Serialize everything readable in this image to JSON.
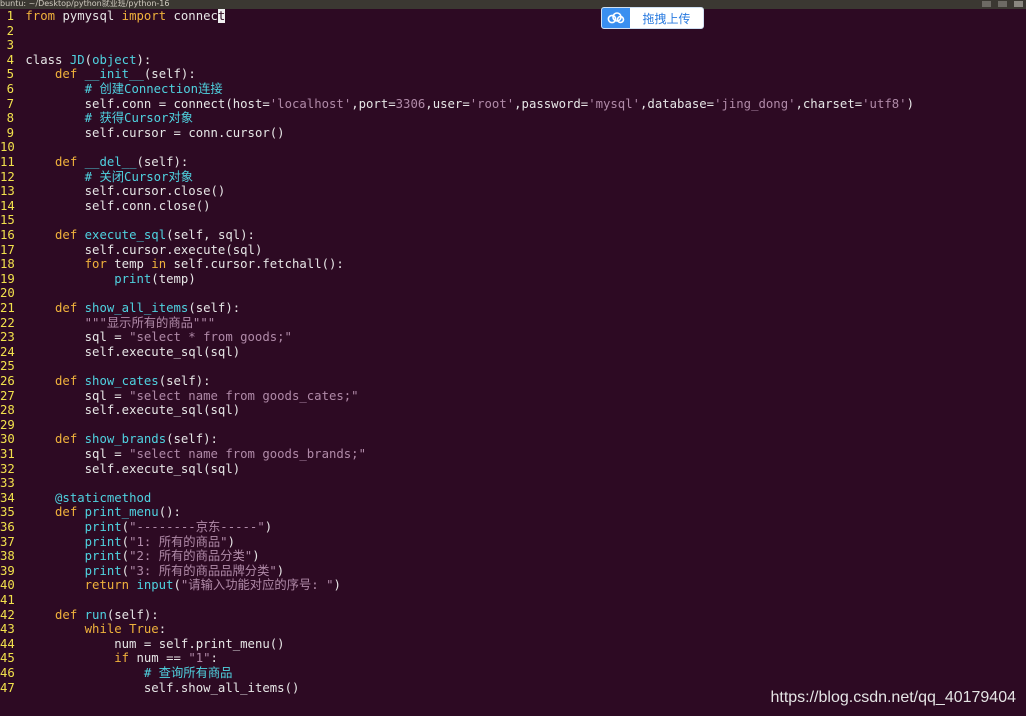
{
  "window": {
    "title": "buntu: ~/Desktop/python就业班/python-16"
  },
  "upload_button": {
    "label": "拖拽上传",
    "icon": "cloud-upload-icon"
  },
  "watermark": {
    "text": "https://blog.csdn.net/qq_40179404"
  },
  "colors": {
    "background": "#2d0a23",
    "line_number": "#f2e14c",
    "keyword": "#f0b23c",
    "function_name": "#4fd2e0",
    "string": "#b08aa8",
    "comment": "#4fd2e0",
    "number": "#b08aa8",
    "text": "#e6e6e6"
  },
  "code_lines": [
    {
      "n": "1",
      "text": "from pymysql import connec"
    },
    {
      "n": "2",
      "text": ""
    },
    {
      "n": "3",
      "text": ""
    },
    {
      "n": "4",
      "text": "class JD(object):"
    },
    {
      "n": "5",
      "text": "    def __init__(self):"
    },
    {
      "n": "6",
      "text": "        # 创建Connection连接"
    },
    {
      "n": "7",
      "text": "        self.conn = connect(host='localhost',port=3306,user='root',password='mysql',database='jing_dong',charset='utf8')"
    },
    {
      "n": "8",
      "text": "        # 获得Cursor对象"
    },
    {
      "n": "9",
      "text": "        self.cursor = conn.cursor()"
    },
    {
      "n": "10",
      "text": ""
    },
    {
      "n": "11",
      "text": "    def __del__(self):"
    },
    {
      "n": "12",
      "text": "        # 关闭Cursor对象"
    },
    {
      "n": "13",
      "text": "        self.cursor.close()"
    },
    {
      "n": "14",
      "text": "        self.conn.close()"
    },
    {
      "n": "15",
      "text": ""
    },
    {
      "n": "16",
      "text": "    def execute_sql(self, sql):"
    },
    {
      "n": "17",
      "text": "        self.cursor.execute(sql)"
    },
    {
      "n": "18",
      "text": "        for temp in self.cursor.fetchall():"
    },
    {
      "n": "19",
      "text": "            print(temp)"
    },
    {
      "n": "20",
      "text": ""
    },
    {
      "n": "21",
      "text": "    def show_all_items(self):"
    },
    {
      "n": "22",
      "text": "        \"\"\"显示所有的商品\"\"\""
    },
    {
      "n": "23",
      "text": "        sql = \"select * from goods;\""
    },
    {
      "n": "24",
      "text": "        self.execute_sql(sql)"
    },
    {
      "n": "25",
      "text": ""
    },
    {
      "n": "26",
      "text": "    def show_cates(self):"
    },
    {
      "n": "27",
      "text": "        sql = \"select name from goods_cates;\""
    },
    {
      "n": "28",
      "text": "        self.execute_sql(sql)"
    },
    {
      "n": "29",
      "text": ""
    },
    {
      "n": "30",
      "text": "    def show_brands(self):"
    },
    {
      "n": "31",
      "text": "        sql = \"select name from goods_brands;\""
    },
    {
      "n": "32",
      "text": "        self.execute_sql(sql)"
    },
    {
      "n": "33",
      "text": ""
    },
    {
      "n": "34",
      "text": "    @staticmethod"
    },
    {
      "n": "35",
      "text": "    def print_menu():"
    },
    {
      "n": "36",
      "text": "        print(\"--------京东-----\")"
    },
    {
      "n": "37",
      "text": "        print(\"1: 所有的商品\")"
    },
    {
      "n": "38",
      "text": "        print(\"2: 所有的商品分类\")"
    },
    {
      "n": "39",
      "text": "        print(\"3: 所有的商品品牌分类\")"
    },
    {
      "n": "40",
      "text": "        return input(\"请输入功能对应的序号: \")"
    },
    {
      "n": "41",
      "text": ""
    },
    {
      "n": "42",
      "text": "    def run(self):"
    },
    {
      "n": "43",
      "text": "        while True:"
    },
    {
      "n": "44",
      "text": "            num = self.print_menu()"
    },
    {
      "n": "45",
      "text": "            if num == \"1\":"
    },
    {
      "n": "46",
      "text": "                # 查询所有商品"
    },
    {
      "n": "47",
      "text": "                self.show_all_items()"
    }
  ],
  "cursor_char": "t"
}
